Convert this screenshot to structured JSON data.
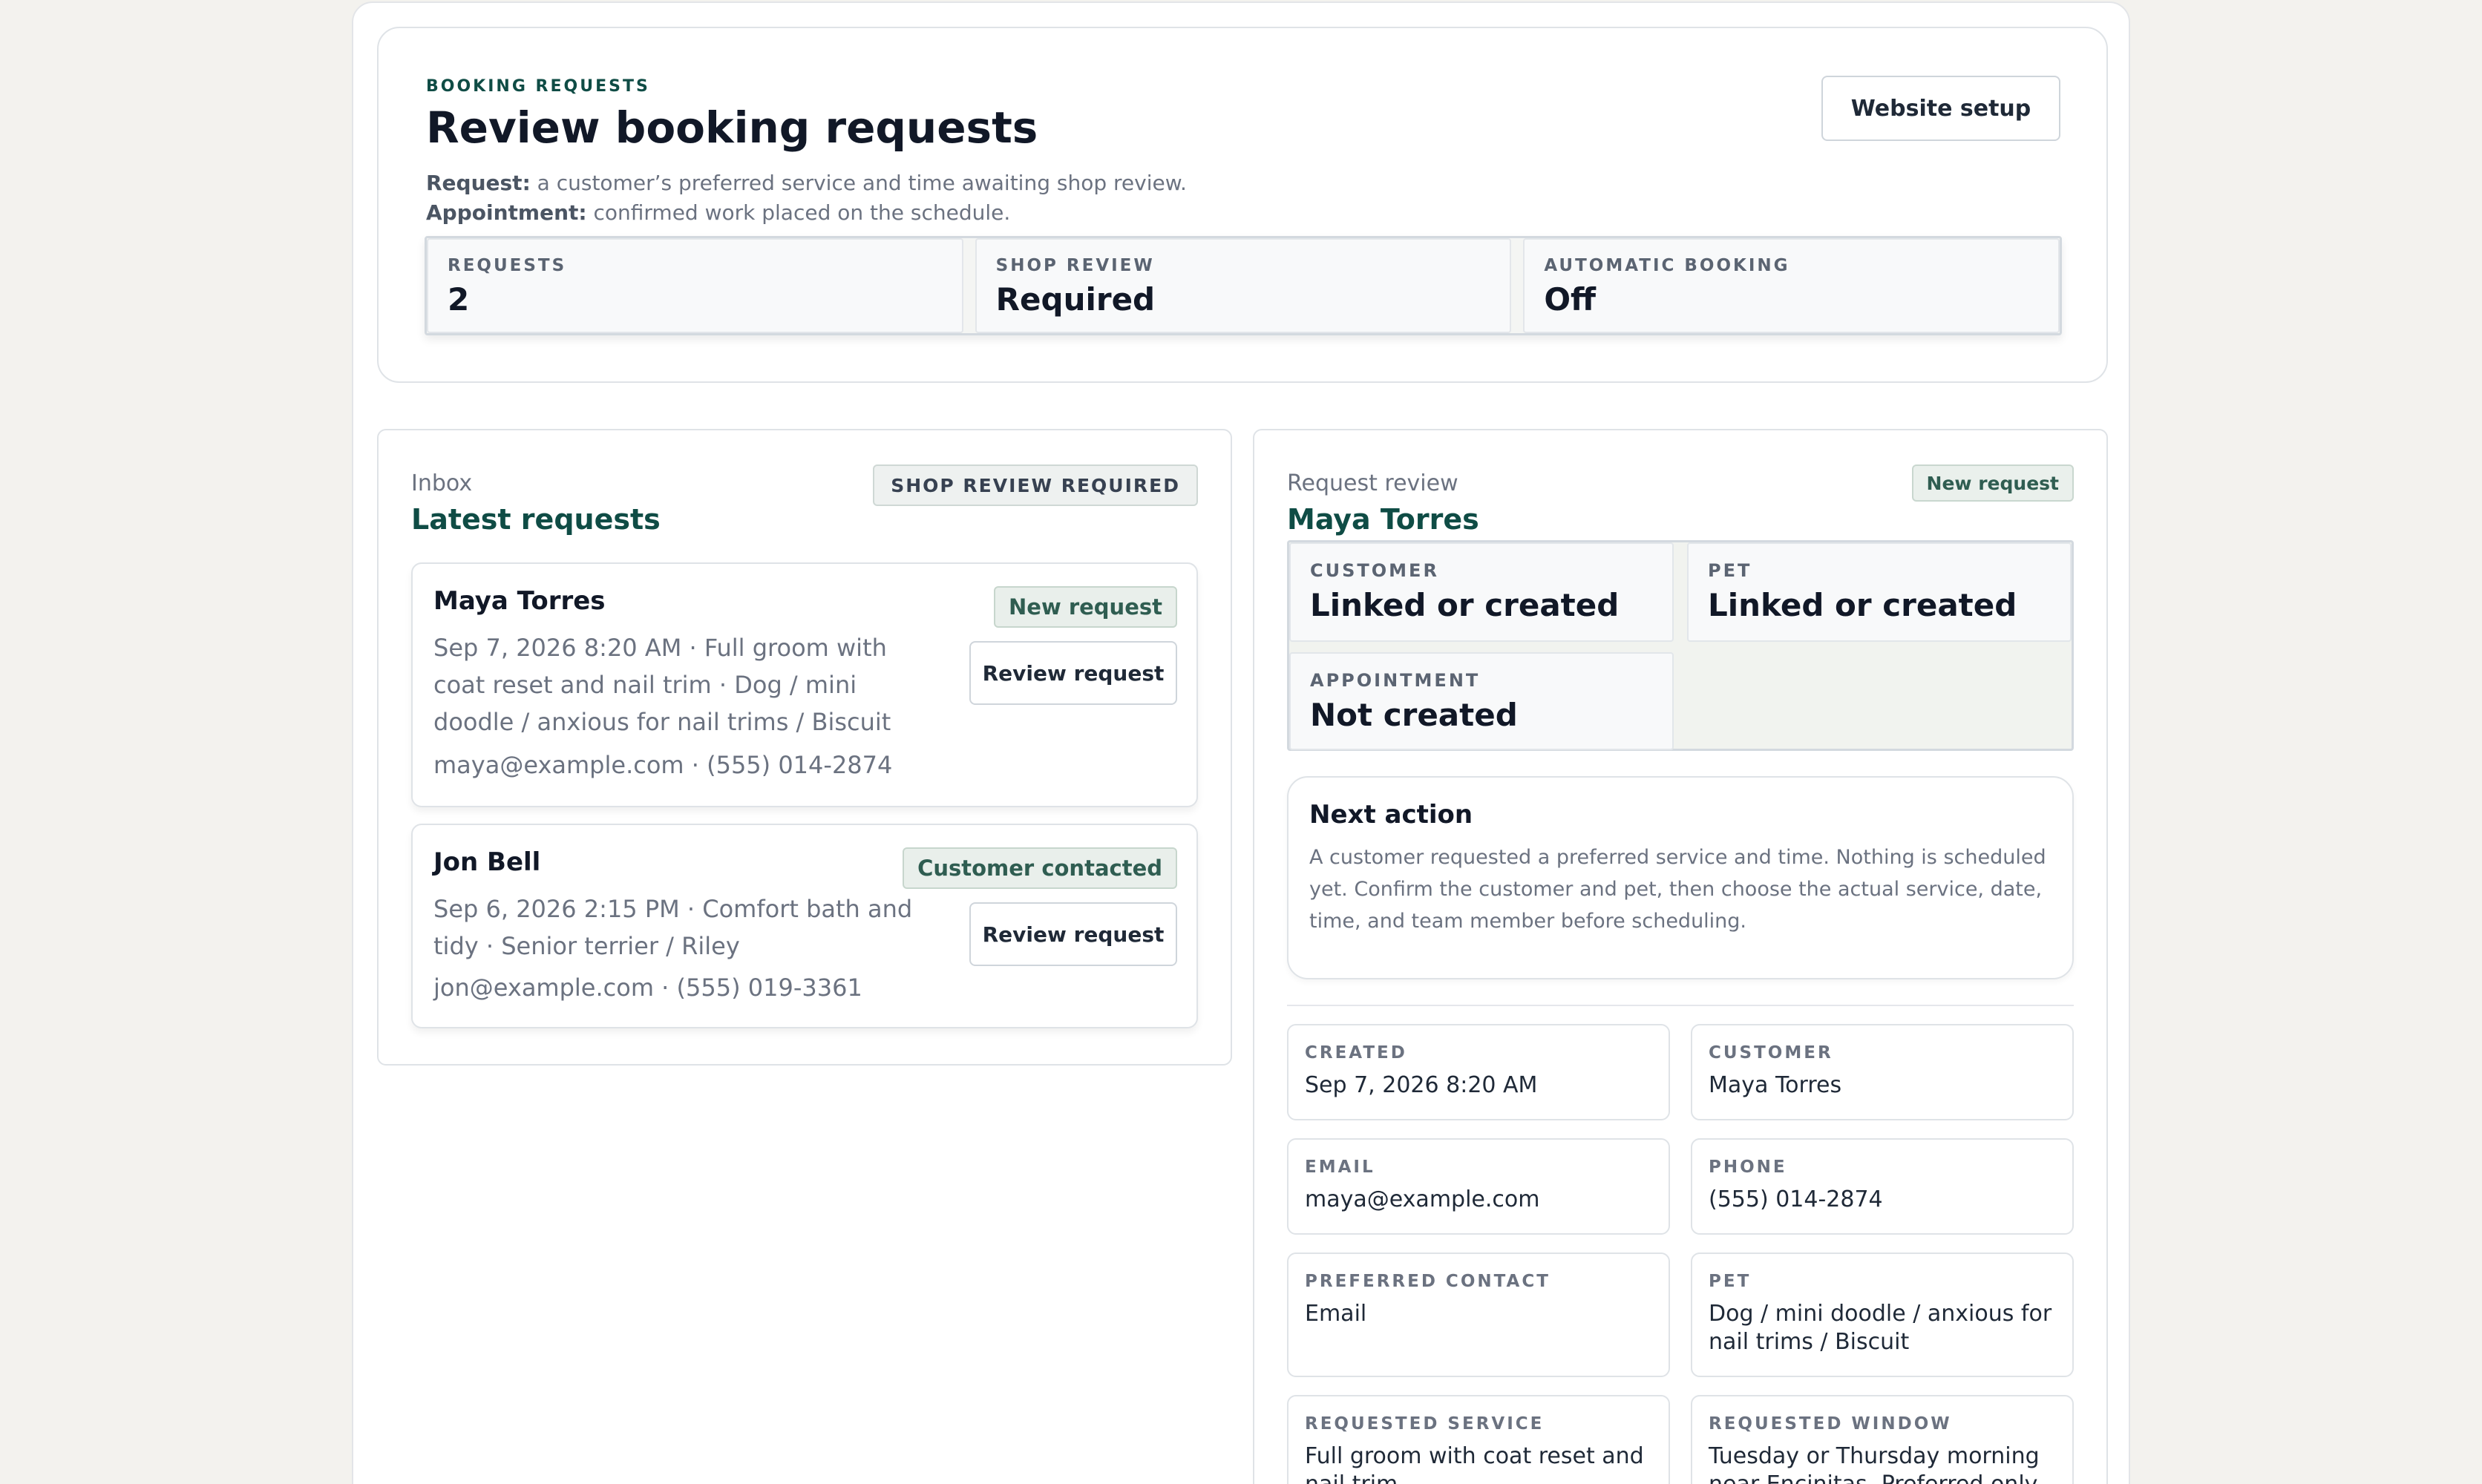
{
  "header": {
    "eyebrow": "BOOKING REQUESTS",
    "title": "Review booking requests",
    "def_request_term": "Request:",
    "def_request_text": " a customer’s preferred service and time awaiting shop review.",
    "def_appt_term": "Appointment:",
    "def_appt_text": " confirmed work placed on the schedule.",
    "setup_button": "Website setup"
  },
  "stats": [
    {
      "label": "REQUESTS",
      "value": "2"
    },
    {
      "label": "SHOP REVIEW",
      "value": "Required"
    },
    {
      "label": "AUTOMATIC BOOKING",
      "value": "Off"
    }
  ],
  "inbox": {
    "kicker": "Inbox",
    "title": "Latest requests",
    "pill": "SHOP REVIEW REQUIRED",
    "requests": [
      {
        "name": "Maya Torres",
        "badge": "New request",
        "details": "Sep 7, 2026 8:20 AM · Full groom with coat reset and nail trim · Dog / mini doodle / anxious for nail trims / Biscuit",
        "contact": "maya@example.com · (555) 014-2874",
        "action": "Review request"
      },
      {
        "name": "Jon Bell",
        "badge": "Customer contacted",
        "details": "Sep 6, 2026 2:15 PM · Comfort bath and tidy · Senior terrier / Riley",
        "contact": "jon@example.com · (555) 019-3361",
        "action": "Review request"
      }
    ]
  },
  "review": {
    "kicker": "Request review",
    "title": "Maya Torres",
    "badge": "New request",
    "links": [
      {
        "label": "CUSTOMER",
        "value": "Linked or created"
      },
      {
        "label": "PET",
        "value": "Linked or created"
      },
      {
        "label": "APPOINTMENT",
        "value": "Not created"
      }
    ],
    "next_action": {
      "title": "Next action",
      "text": "A customer requested a preferred service and time. Nothing is scheduled yet. Confirm the customer and pet, then choose the actual service, date, time, and team member before scheduling."
    },
    "fields": [
      {
        "label": "CREATED",
        "value": "Sep 7, 2026 8:20 AM"
      },
      {
        "label": "CUSTOMER",
        "value": "Maya Torres"
      },
      {
        "label": "EMAIL",
        "value": "maya@example.com"
      },
      {
        "label": "PHONE",
        "value": "(555) 014-2874"
      },
      {
        "label": "PREFERRED CONTACT",
        "value": "Email"
      },
      {
        "label": "PET",
        "value": "Dog / mini doodle / anxious for nail trims / Biscuit"
      },
      {
        "label": "REQUESTED SERVICE",
        "value": "Full groom with coat reset and nail trim"
      },
      {
        "label": "REQUESTED WINDOW",
        "value": "Tuesday or Thursday morning near Encinitas. Preferred only —"
      }
    ]
  }
}
